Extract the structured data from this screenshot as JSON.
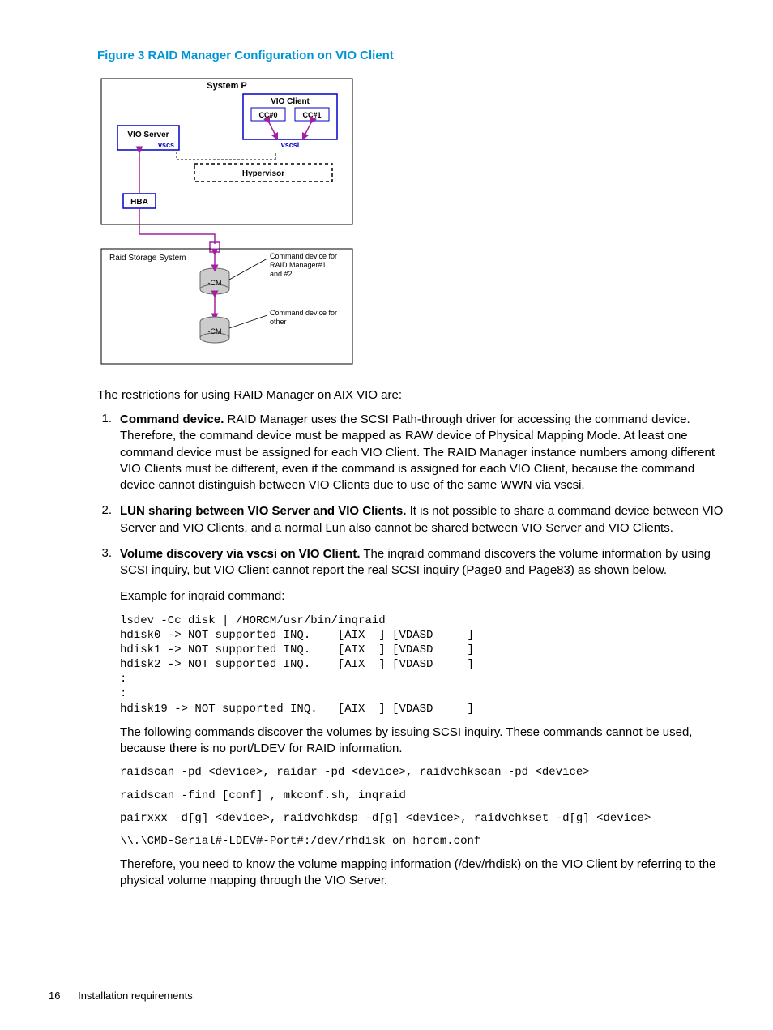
{
  "figure_caption": "Figure 3 RAID Manager Configuration on VIO Client",
  "diagram": {
    "system_p": "System P",
    "vio_client": "VIO Client",
    "cc0": "CC#0",
    "cc1": "CC#1",
    "vio_server": "VIO Server",
    "vscs": "vscs",
    "vscsi": "vscsi",
    "hypervisor": "Hypervisor",
    "hba": "HBA",
    "raid_storage": "Raid Storage System",
    "cm1": "-CM",
    "cm2": "-CM",
    "cmd_dev_1": "Command device for RAID Manager#1 and #2",
    "cmd_dev_2": "Command device for other"
  },
  "intro": "The restrictions for using RAID Manager on AIX VIO are:",
  "items": [
    {
      "num": "1.",
      "bold": "Command device.",
      "text": " RAID Manager uses the SCSI Path-through driver for accessing the command device. Therefore, the command device must be mapped as RAW device of Physical Mapping Mode. At least one command device must be assigned for each VIO Client. The RAID Manager instance numbers among different VIO Clients must be different, even if the command is assigned for each VIO Client, because the command device cannot distinguish between VIO Clients due to use of the same WWN via vscsi."
    },
    {
      "num": "2.",
      "bold": "LUN sharing between VIO Server and VIO Clients.",
      "text": " It is not possible to share a command device between VIO Server and VIO Clients, and a normal Lun also cannot be shared between VIO Server and VIO Clients."
    },
    {
      "num": "3.",
      "bold": "Volume discovery via vscsi on VIO Client.",
      "text": " The inqraid command discovers the volume information by using SCSI inquiry, but VIO Client cannot report the real SCSI inquiry (Page0 and Page83) as shown below."
    }
  ],
  "example_label": "Example for inqraid command:",
  "code1": "lsdev -Cc disk | /HORCM/usr/bin/inqraid\nhdisk0 -> NOT supported INQ.    [AIX  ] [VDASD     ]\nhdisk1 -> NOT supported INQ.    [AIX  ] [VDASD     ]\nhdisk2 -> NOT supported INQ.    [AIX  ] [VDASD     ]\n:\n:\nhdisk19 -> NOT supported INQ.   [AIX  ] [VDASD     ]",
  "post_code1": "The following commands discover the volumes by issuing SCSI inquiry. These commands cannot be used, because there is no port/LDEV for RAID information.",
  "code2": "raidscan -pd <device>, raidar -pd <device>, raidvchkscan -pd <device>",
  "code3": "raidscan -find [conf] , mkconf.sh, inqraid",
  "code4": "pairxxx -d[g] <device>, raidvchkdsp -d[g] <device>, raidvchkset -d[g] <device>",
  "code5": "\\\\.\\CMD-Serial#-LDEV#-Port#:/dev/rhdisk on horcm.conf",
  "conclusion": "Therefore, you need to know the volume mapping information (/dev/rhdisk) on the VIO Client by referring to the physical volume mapping through the VIO Server.",
  "footer": {
    "page": "16",
    "section": "Installation requirements"
  }
}
